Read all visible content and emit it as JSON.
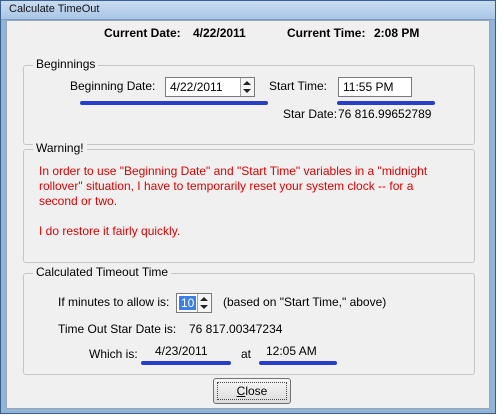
{
  "window": {
    "title": "Calculate TimeOut"
  },
  "header": {
    "current_date_label": "Current Date:",
    "current_date_value": "4/22/2011",
    "current_time_label": "Current Time:",
    "current_time_value": "2:08 PM"
  },
  "beginnings": {
    "title": "Beginnings",
    "date_label": "Beginning Date:",
    "date_value": "4/22/2011",
    "time_label": "Start Time:",
    "time_value": "11:55 PM",
    "star_date_label": "Star Date:",
    "star_date_value": "76 816.99652789"
  },
  "warning": {
    "title": "Warning!",
    "line1": "In order to use \"Beginning Date\" and \"Start Time\" variables in a \"midnight",
    "line2": "rollover\" situation, I have to temporarily reset your system clock -- for a",
    "line3": "second or two.",
    "line4": "I do restore it fairly quickly."
  },
  "calculated": {
    "title": "Calculated Timeout Time",
    "minutes_label": "If minutes to allow is:",
    "minutes_value": "10",
    "minutes_note": "(based on \"Start Time,\" above)",
    "timeout_star_label": "Time Out Star Date is:",
    "timeout_star_value": "76 817.00347234",
    "which_label": "Which is:",
    "which_date": "4/23/2011",
    "at_label": "at",
    "which_time": "12:05 AM"
  },
  "close_button": {
    "label_accel": "C",
    "label_rest": "lose"
  },
  "colors": {
    "annotation_underline": "#2a3dc8",
    "warning_text": "#e00000",
    "selection": "#3b7ee6"
  }
}
